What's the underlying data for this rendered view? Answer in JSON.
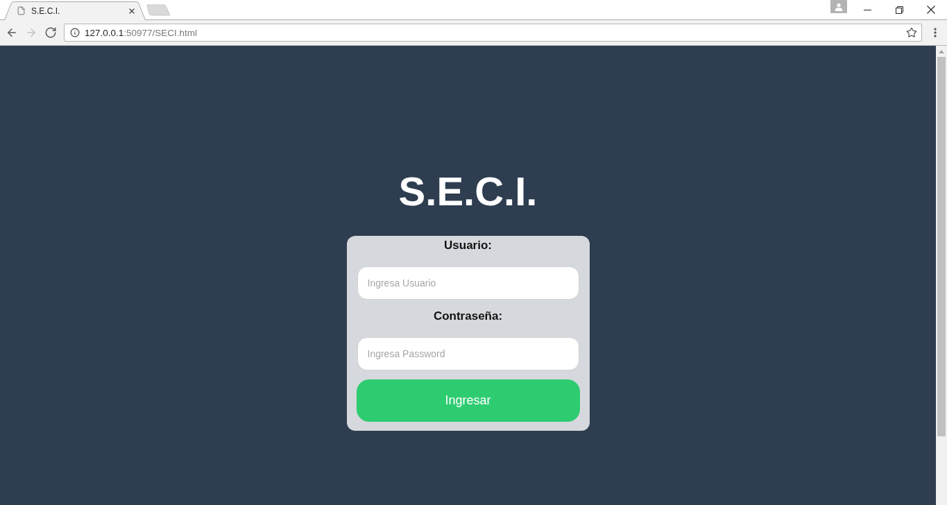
{
  "browser": {
    "tabs": [
      {
        "title": "S.E.C.I.",
        "selected": true
      }
    ],
    "nav_buttons": [
      {
        "kind": "back",
        "disabled": false
      },
      {
        "kind": "forward",
        "disabled": true
      },
      {
        "kind": "reload",
        "disabled": false
      }
    ],
    "url": {
      "host": "127.0.0.1",
      "rest": ":50977/SECI.html"
    }
  },
  "page": {
    "title": "S.E.C.I.",
    "form": {
      "fields": [
        {
          "label": "Usuario:",
          "placeholder": "Ingresa Usuario"
        },
        {
          "label": "Contraseña:",
          "placeholder": "Ingresa Password"
        }
      ],
      "submit": "Ingresar"
    }
  }
}
